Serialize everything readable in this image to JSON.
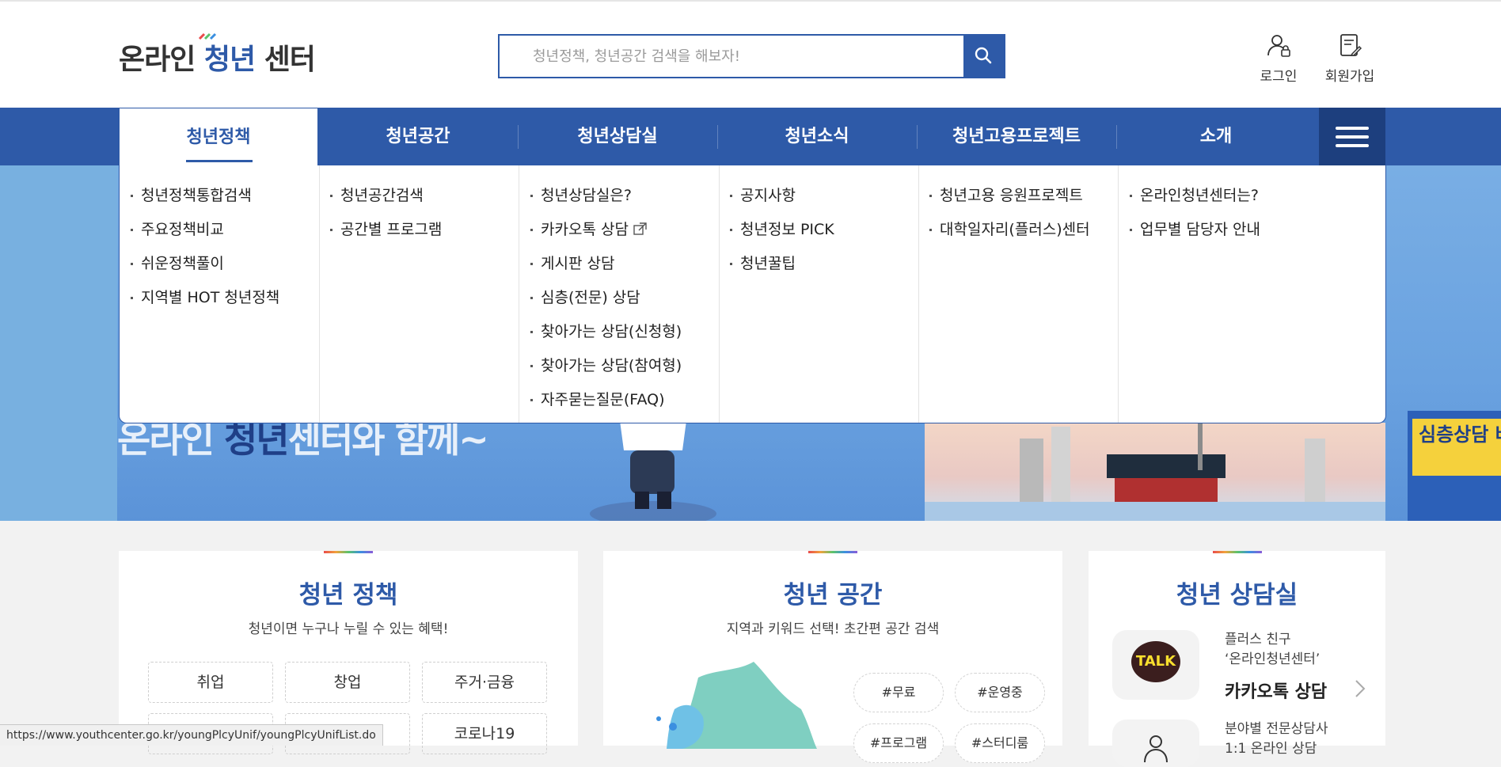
{
  "header": {
    "logo": {
      "part1": "온라인 ",
      "highlight": "청년",
      "part2": " 센터"
    },
    "search": {
      "placeholder": "청년정책, 청년공간 검색을 해보자!",
      "button_icon": "search-icon"
    },
    "login_label": "로그인",
    "join_label": "회원가입"
  },
  "nav": {
    "items": [
      {
        "label": "청년정책",
        "active": true
      },
      {
        "label": "청년공간"
      },
      {
        "label": "청년상담실"
      },
      {
        "label": "청년소식"
      },
      {
        "label": "청년고용프로젝트"
      },
      {
        "label": "소개"
      }
    ],
    "menu_icon": "hamburger-menu-icon"
  },
  "megamenu": {
    "columns": [
      {
        "items": [
          "청년정책통합검색",
          "주요정책비교",
          "쉬운정책풀이",
          "지역별 HOT 청년정책"
        ]
      },
      {
        "items": [
          "청년공간검색",
          "공간별 프로그램"
        ]
      },
      {
        "items": [
          "청년상담실은?",
          "카카오톡 상담",
          "게시판 상담",
          "심층(전문) 상담",
          "찾아가는 상담(신청형)",
          "찾아가는 상담(참여형)",
          "자주묻는질문(FAQ)"
        ]
      },
      {
        "items": [
          "공지사항",
          "청년정보 PICK",
          "청년꿀팁"
        ]
      },
      {
        "items": [
          "청년고용 응원프로젝트",
          "대학일자리(플러스)센터"
        ]
      },
      {
        "items": [
          "온라인청년센터는?",
          "업무별 담당자 안내"
        ]
      }
    ]
  },
  "banner": {
    "text_a": "온라인 ",
    "text_b": "청년",
    "text_c": "센터와 함께~",
    "side_badge": "심층상담 바로가기"
  },
  "cards": {
    "policy": {
      "title": "청년 정책",
      "subtitle": "청년이면 누구나 누릴 수 있는 혜택!",
      "chips": [
        "취업",
        "창업",
        "주거·금융",
        "",
        "",
        "코로나19"
      ]
    },
    "space": {
      "title": "청년 공간",
      "subtitle": "지역과 키워드 선택! 초간편 공간 검색",
      "tags": [
        "#무료",
        "#운영중",
        "#프로그램",
        "#스터디룸"
      ]
    },
    "counsel": {
      "title": "청년 상담실",
      "kakao_badge": "TALK",
      "kakao_line1": "플러스 친구",
      "kakao_line2": "‘온라인청년센터’",
      "kakao_title": "카카오톡 상담",
      "expert_line1": "분야별 전문상담사",
      "expert_line2": "1:1 온라인 상담"
    }
  },
  "statusbar": {
    "url": "https://www.youthcenter.go.kr/youngPlcyUnif/youngPlcyUnifList.do"
  },
  "colors": {
    "brand": "#2e5aa8",
    "brand_dark": "#1d3f7e",
    "kakao_yellow": "#f9df2e"
  }
}
